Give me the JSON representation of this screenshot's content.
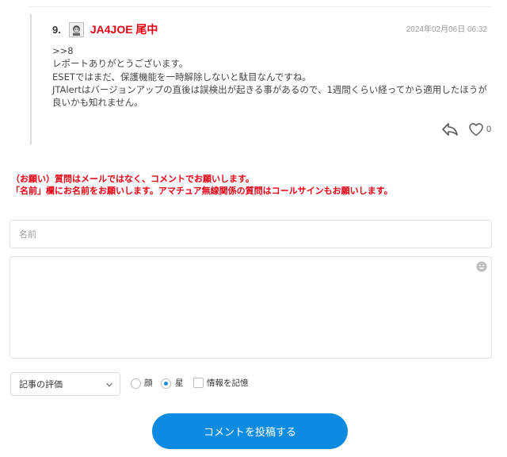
{
  "comment": {
    "number": "9.",
    "author": "JA4JOE 尾中",
    "date": "2024年02月06日 06:32",
    "lines": [
      ">>8",
      "レポートありがとうございます。",
      "ESETではまだ、保護機能を一時解除しないと駄目なんですね。",
      "JTAlertはバージョンアップの直後は誤検出が起きる事があるので、1週間くらい経ってから適用したほうが",
      "良いかも知れません。"
    ],
    "like_count": "0",
    "icons": {
      "avatar": "avatar-image",
      "reply": "reply-arrow-icon",
      "like": "heart-icon"
    }
  },
  "notice": {
    "line1": "（お願い）質問はメールではなく、コメントでお願いします。",
    "line2": "「名前」欄にお名前をお願いします。アマチュア無線関係の質問はコールサインもお願いします。"
  },
  "form": {
    "name_placeholder": "名前",
    "name_value": "",
    "comment_value": "",
    "rating_label": "記事の評価",
    "rating_options": [
      {
        "label": "顔",
        "checked": false
      },
      {
        "label": "星",
        "checked": true
      }
    ],
    "remember_label": "情報を記憶",
    "remember_checked": false,
    "submit_label": "コメントを投稿する"
  },
  "colors": {
    "author": "#e60012",
    "notice": "#e60012",
    "accent": "#0d8be0",
    "date": "#9a9a9a"
  }
}
